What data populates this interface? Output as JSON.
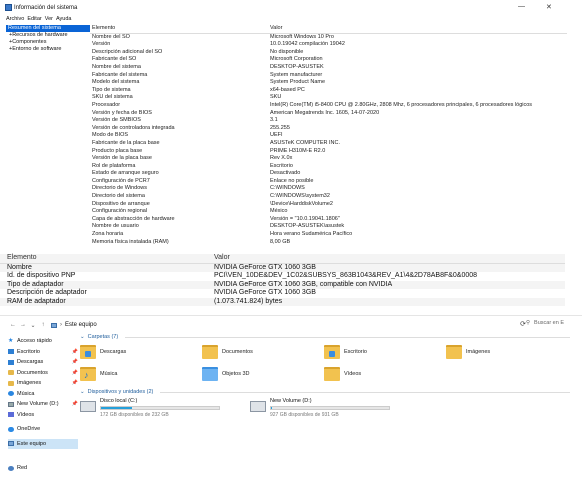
{
  "sysinfo": {
    "title": "Información del sistema",
    "menu": [
      "Archivo",
      "Editar",
      "Ver",
      "Ayuda"
    ],
    "tree": [
      {
        "label": "Resumen del sistema",
        "selected": true
      },
      {
        "label": "+Recursos de hardware",
        "selected": false
      },
      {
        "label": "+Componentes",
        "selected": false
      },
      {
        "label": "+Entorno de software",
        "selected": false
      }
    ],
    "columns": {
      "element": "Elemento",
      "value": "Valor"
    },
    "rows": [
      [
        "Nombre del SO",
        "Microsoft Windows 10 Pro"
      ],
      [
        "Versión",
        "10.0.19042 compilación 19042"
      ],
      [
        "Descripción adicional del SO",
        "No disponible"
      ],
      [
        "Fabricante del SO",
        "Microsoft Corporation"
      ],
      [
        "Nombre del sistema",
        "DESKTOP-ASUSTEK"
      ],
      [
        "Fabricante del sistema",
        "System manufacturer"
      ],
      [
        "Modelo del sistema",
        "System Product Name"
      ],
      [
        "Tipo de sistema",
        "x64-based PC"
      ],
      [
        "SKU del sistema",
        "SKU"
      ],
      [
        "Procesador",
        "Intel(R) Core(TM) i5-8400 CPU @ 2.80GHz, 2808 Mhz, 6 procesadores principales, 6 procesadores lógicos"
      ],
      [
        "Versión y fecha de BIOS",
        "American Megatrends Inc. 1605, 14-07-2020"
      ],
      [
        "Versión de SMBIOS",
        "3.1"
      ],
      [
        "Versión de controladora integrada",
        "255.255"
      ],
      [
        "Modo de BIOS",
        "UEFI"
      ],
      [
        "Fabricante de la placa base",
        "ASUSTeK COMPUTER INC."
      ],
      [
        "Producto placa base",
        "PRIME H310M-E R2.0"
      ],
      [
        "Versión de la placa base",
        "Rev X.0x"
      ],
      [
        "Rol de plataforma",
        "Escritorio"
      ],
      [
        "Estado de arranque seguro",
        "Desactivado"
      ],
      [
        "Configuración de PCR7",
        "Enlace no posible"
      ],
      [
        "Directorio de Windows",
        "C:\\WINDOWS"
      ],
      [
        "Directorio del sistema",
        "C:\\WINDOWS\\system32"
      ],
      [
        "Dispositivo de arranque",
        "\\Device\\HarddiskVolume2"
      ],
      [
        "Configuración regional",
        "México"
      ],
      [
        "Capa de abstracción de hardware",
        "Versión = \"10.0.19041.1806\""
      ],
      [
        "Nombre de usuario",
        "DESKTOP-ASUSTEK\\asustek"
      ],
      [
        "Zona horaria",
        "Hora verano Sudamérica Pacífico"
      ],
      [
        "Memoria física instalada (RAM)",
        "8,00 GB"
      ]
    ]
  },
  "gpu": {
    "columns": {
      "element": "Elemento",
      "value": "Valor"
    },
    "rows": [
      [
        "Nombre",
        "NVIDIA GeForce GTX 1060 3GB"
      ],
      [
        "Id. de dispositivo PNP",
        "PCI\\VEN_10DE&DEV_1C02&SUBSYS_863B1043&REV_A1\\4&2D78AB8F&0&0008"
      ],
      [
        "Tipo de adaptador",
        "NVIDIA GeForce GTX 1060 3GB, compatible con NVIDIA"
      ],
      [
        "Descripción de adaptador",
        "NVIDIA GeForce GTX 1060 3GB"
      ],
      [
        "RAM de adaptador",
        "(1.073.741.824) bytes"
      ]
    ]
  },
  "explorer": {
    "breadcrumb": "Este equipo",
    "search_placeholder": "Buscar en E",
    "nav": [
      {
        "label": "Acceso rápido",
        "icon": "star-icon",
        "pinned": false
      },
      {
        "label": "Escritorio",
        "icon": "desktop-icon",
        "pinned": true
      },
      {
        "label": "Descargas",
        "icon": "downloads-icon",
        "pinned": true
      },
      {
        "label": "Documentos",
        "icon": "documents-icon",
        "pinned": true
      },
      {
        "label": "Imágenes",
        "icon": "pictures-icon",
        "pinned": true
      },
      {
        "label": "Música",
        "icon": "music-icon",
        "pinned": false
      },
      {
        "label": "New Volume (D:)",
        "icon": "drive-icon",
        "pinned": true
      },
      {
        "label": "Vídeos",
        "icon": "videos-icon",
        "pinned": false
      },
      {
        "label": "OneDrive",
        "icon": "onedrive-icon",
        "pinned": false
      },
      {
        "label": "Este equipo",
        "icon": "this-pc-icon",
        "pinned": false,
        "selected": true
      },
      {
        "label": "Red",
        "icon": "network-icon",
        "pinned": false
      }
    ],
    "folders_header": "Carpetas (7)",
    "folders": [
      "Descargas",
      "Documentos",
      "Escritorio",
      "Imágenes",
      "Música",
      "Objetos 3D",
      "Vídeos"
    ],
    "drives_header": "Dispositivos y unidades (2)",
    "drives": [
      {
        "name": "Disco local (C:)",
        "free": "172 GB disponibles de 232 GB",
        "used_fraction": 0.26
      },
      {
        "name": "New Volume (D:)",
        "free": "927 GB disponibles de 931 GB",
        "used_fraction": 0.005
      }
    ]
  }
}
